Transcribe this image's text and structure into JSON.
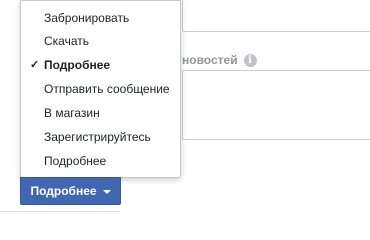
{
  "form": {
    "info_icon_glyph": "i",
    "description_label_partial": "новостей"
  },
  "menu": {
    "selected_index": 2,
    "check_glyph": "✓",
    "items": [
      {
        "label": "Забронировать"
      },
      {
        "label": "Скачать"
      },
      {
        "label": "Подробнее"
      },
      {
        "label": "Отправить сообщение"
      },
      {
        "label": "В магазин"
      },
      {
        "label": "Зарегистрируйтесь"
      },
      {
        "label": "Подробнее"
      }
    ]
  },
  "cta_button": {
    "label": "Подробнее",
    "color": "#4267b2"
  }
}
